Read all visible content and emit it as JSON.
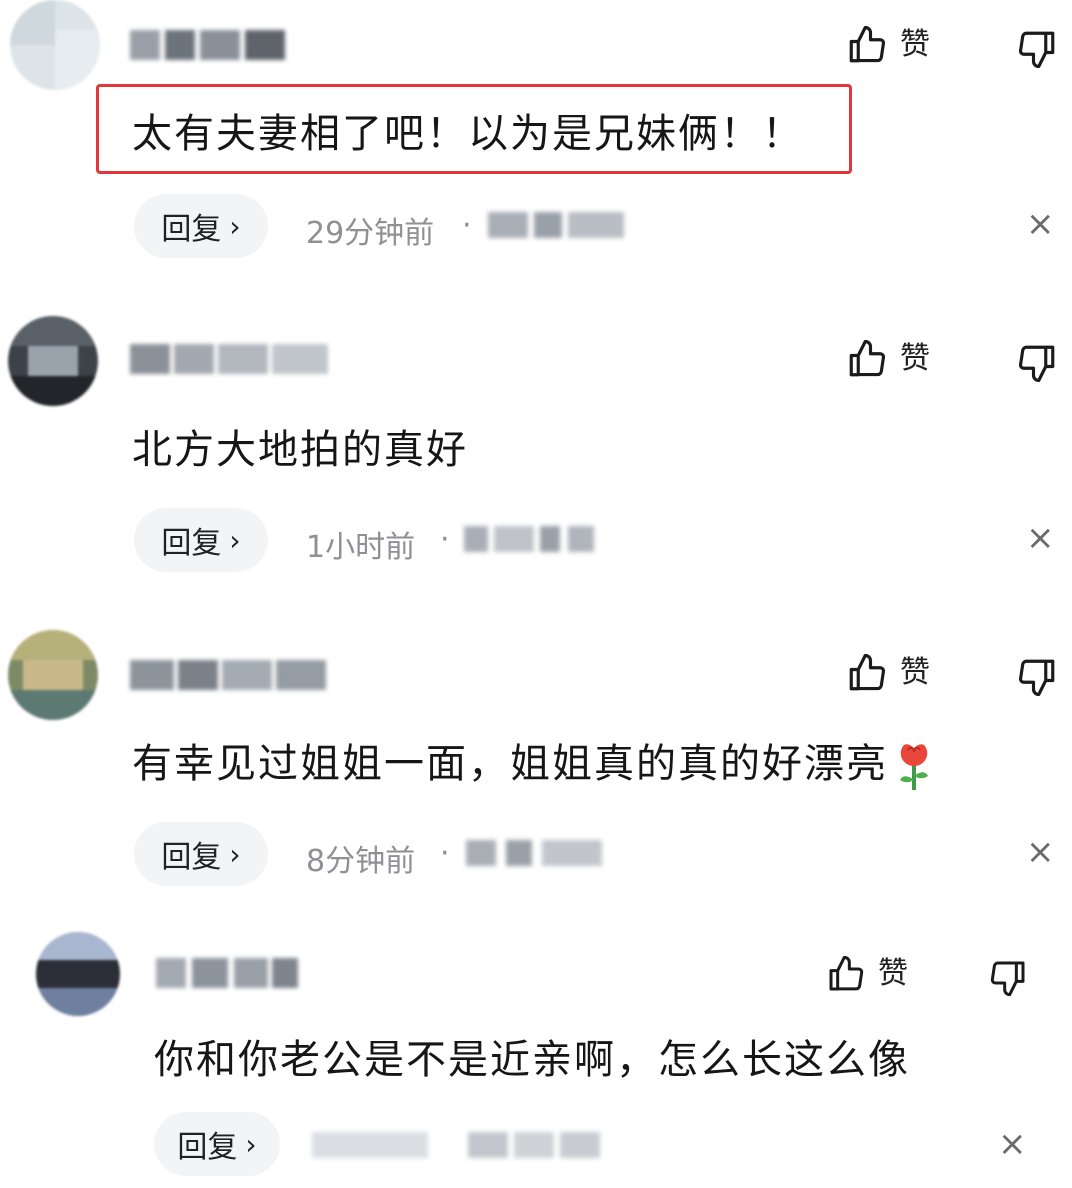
{
  "actions": {
    "like_label": "赞",
    "reply_label": "回复",
    "reply_chevron": "›",
    "close_glyph": "×"
  },
  "comments": [
    {
      "text": "太有夫妻相了吧！以为是兄妹俩！！",
      "time": "29分钟前",
      "separator": "·",
      "highlighted": true
    },
    {
      "text": "北方大地拍的真好",
      "time": "1小时前",
      "separator": "·",
      "highlighted": false
    },
    {
      "text": "有幸见过姐姐一面，姐姐真的真的好漂亮",
      "emoji": "rose-emoji",
      "time": "8分钟前",
      "separator": "·",
      "highlighted": false
    },
    {
      "text": "你和你老公是不是近亲啊，怎么长这么像",
      "time": "",
      "separator": "",
      "highlighted": false
    }
  ],
  "colors": {
    "highlight_border": "#e0363c",
    "reply_bg": "#f3f4f6",
    "time_text": "#8f8f95"
  }
}
